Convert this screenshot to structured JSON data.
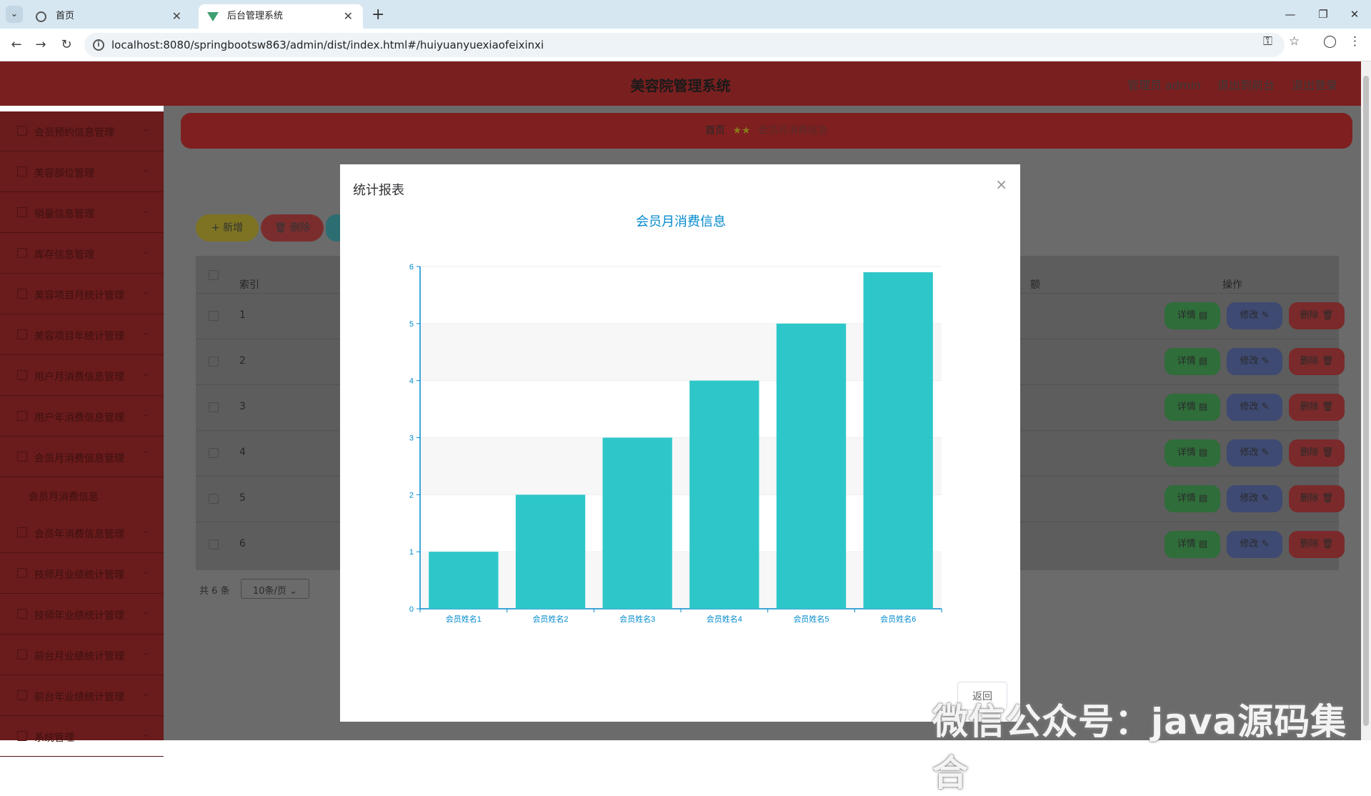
{
  "browser": {
    "tabs": [
      {
        "title": "首页",
        "active": false
      },
      {
        "title": "后台管理系统",
        "active": true
      }
    ],
    "url": "localhost:8080/springbootsw863/admin/dist/index.html#/huiyuanyuexiaofeixinxi"
  },
  "header": {
    "title": "美容院管理系统",
    "user_label": "管理员 admin",
    "to_frontend": "退出到前台",
    "logout": "退出登录"
  },
  "sidebar": {
    "items": [
      {
        "label": "会员预约信息管理"
      },
      {
        "label": "美容部位管理"
      },
      {
        "label": "销量信息管理"
      },
      {
        "label": "库存信息管理"
      },
      {
        "label": "美容项目月统计管理"
      },
      {
        "label": "美容项目年统计管理"
      },
      {
        "label": "用户月消费信息管理"
      },
      {
        "label": "用户年消费信息管理"
      },
      {
        "label": "会员月消费信息管理"
      },
      {
        "label": "会员年消费信息管理"
      },
      {
        "label": "技师月业绩统计管理"
      },
      {
        "label": "技师年业绩统计管理"
      },
      {
        "label": "前台月业绩统计管理"
      },
      {
        "label": "前台年业绩统计管理"
      },
      {
        "label": "系统管理"
      }
    ],
    "sub_item": "会员月消费信息"
  },
  "breadcrumb": {
    "home": "首页",
    "current": "会员月消费信息"
  },
  "toolbar": {
    "add": "新增",
    "delete": "删除"
  },
  "table": {
    "headers": {
      "index": "索引",
      "amount": "额",
      "actions": "操作"
    },
    "rows": [
      "1",
      "2",
      "3",
      "4",
      "5",
      "6"
    ],
    "row_actions": {
      "detail": "详情",
      "edit": "修改",
      "delete": "删除"
    }
  },
  "pagination": {
    "total": "共 6 条",
    "page_size": "10条/页"
  },
  "modal": {
    "title": "统计报表",
    "back": "返回"
  },
  "chart_data": {
    "type": "bar",
    "title": "会员月消费信息",
    "categories": [
      "会员姓名1",
      "会员姓名2",
      "会员姓名3",
      "会员姓名4",
      "会员姓名5",
      "会员姓名6"
    ],
    "values": [
      1,
      2,
      3,
      4,
      5,
      5.9
    ],
    "ylim": [
      0,
      6
    ],
    "yticks": [
      "0",
      "1",
      "2",
      "3",
      "4",
      "5",
      "6"
    ],
    "bar_color": "#2ec7c9",
    "axis_color": "#008acd",
    "grid": true
  },
  "watermark": "微信公众号：java源码集合"
}
